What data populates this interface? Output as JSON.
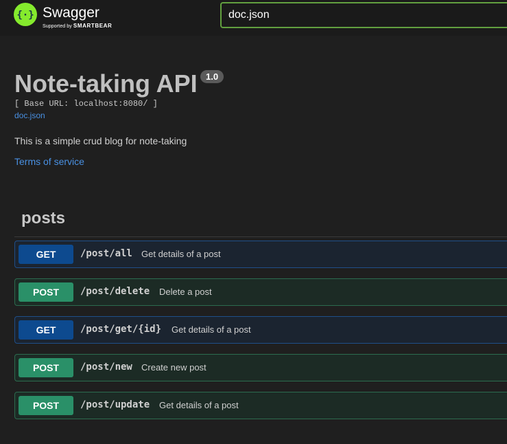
{
  "header": {
    "brand": "Swagger",
    "tagline_prefix": "Supported by",
    "tagline_brand": "SMARTBEAR",
    "search_value": "doc.json"
  },
  "info": {
    "title": "Note-taking API",
    "version": "1.0",
    "base_url": "[ Base URL: localhost:8080/ ]",
    "spec_link": "doc.json",
    "description": "This is a simple crud blog for note-taking",
    "terms_link": "Terms of service"
  },
  "tag": {
    "name": "posts"
  },
  "operations": [
    {
      "method": "GET",
      "path": "/post/all",
      "summary": "Get details of a post"
    },
    {
      "method": "POST",
      "path": "/post/delete",
      "summary": "Delete a post"
    },
    {
      "method": "GET",
      "path": "/post/get/{id}",
      "summary": "Get details of a post"
    },
    {
      "method": "POST",
      "path": "/post/new",
      "summary": "Create new post"
    },
    {
      "method": "POST",
      "path": "/post/update",
      "summary": "Get details of a post"
    }
  ],
  "colors": {
    "brand_green": "#85ea2d",
    "get": "#0d4a8f",
    "post": "#2a9068",
    "link": "#4990e2"
  }
}
